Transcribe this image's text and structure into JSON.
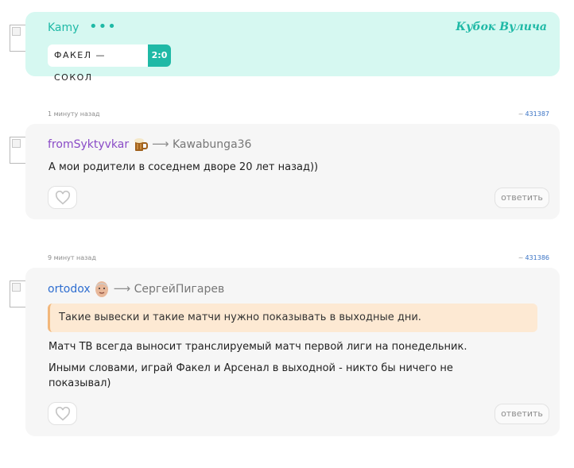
{
  "top_post": {
    "username": "Kamy",
    "menu_icon": "dots-icon",
    "cup_title": "Кубок Вулича",
    "match": "ФАКЕЛ — СОКОЛ",
    "score": "2:0",
    "colors": {
      "accent": "#1fb9a6",
      "card": "#d6f8f1"
    }
  },
  "comments": [
    {
      "time": "1 минуту назад",
      "id": "431387",
      "author": "fromSyktyvkar",
      "author_color": "#8a4bc7",
      "author_badge": "beer-mug-icon",
      "arrow": "⟶",
      "reply_to": "Kawabunga36",
      "text": "А мои родители в соседнем дворе 20 лет назад))",
      "reply_label": "ответить"
    },
    {
      "time": "9 минут назад",
      "id": "431386",
      "author": "ortodox",
      "author_color": "#2f6ed0",
      "author_badge": "face-avatar-icon",
      "arrow": "⟶",
      "reply_to": "СергейПигарев",
      "quote": "Такие вывески и такие матчи нужно показывать в выходные дни.",
      "text_lines": [
        "Матч ТВ всегда выносит транслируемый матч первой лиги на понедельник.",
        "Иными словами, играй Факел и Арсенал в выходной - никто бы ничего не",
        "показывал)"
      ],
      "reply_label": "ответить"
    }
  ],
  "id_prefix": "~"
}
